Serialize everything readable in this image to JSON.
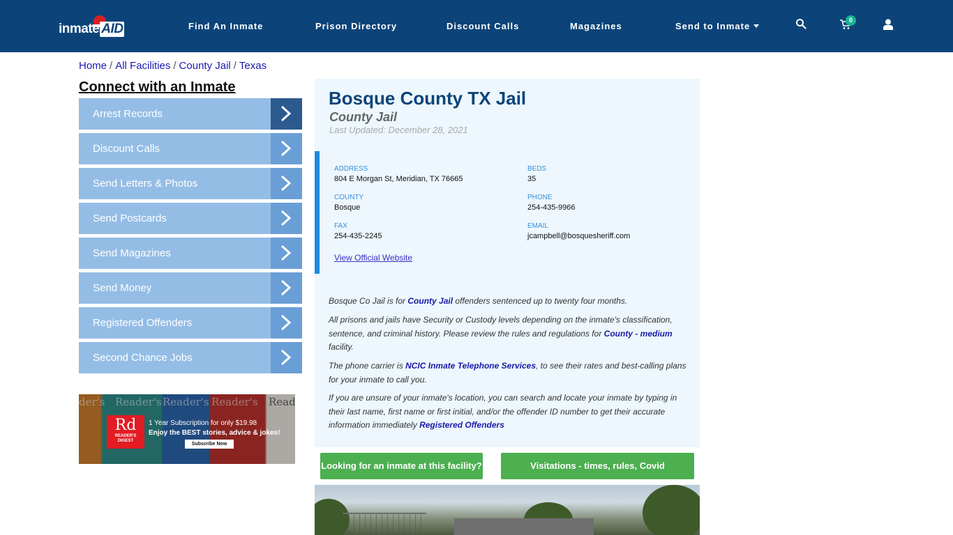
{
  "header": {
    "logo_text": "inmate",
    "logo_accent": "AID",
    "nav": [
      {
        "label": "Find An Inmate"
      },
      {
        "label": "Prison Directory"
      },
      {
        "label": "Discount Calls"
      },
      {
        "label": "Magazines"
      },
      {
        "label": "Send to Inmate"
      }
    ],
    "cart_count": "0",
    "icons": [
      "search-icon",
      "cart-icon",
      "user-icon"
    ]
  },
  "breadcrumb": [
    "Home",
    "All Facilities",
    "County Jail",
    "Texas"
  ],
  "sidebar": {
    "title": "Connect with an Inmate",
    "items": [
      {
        "label": "Arrest Records"
      },
      {
        "label": "Discount Calls"
      },
      {
        "label": "Send Letters & Photos"
      },
      {
        "label": "Send Postcards"
      },
      {
        "label": "Send Magazines"
      },
      {
        "label": "Send Money"
      },
      {
        "label": "Registered Offenders"
      },
      {
        "label": "Second Chance Jobs"
      }
    ]
  },
  "ad": {
    "brand_big": "Rd",
    "brand_small_1": "READER'S",
    "brand_small_2": "DIGEST",
    "line1": "1 Year Subscription for only $19.98",
    "line2": "Enjoy the BEST stories, advice & jokes!",
    "button": "Subscribe Now"
  },
  "facility": {
    "name": "Bosque County TX Jail",
    "type": "County Jail",
    "last_updated": "Last Updated: December 28, 2021",
    "fields": {
      "address_label": "ADDRESS",
      "address": "804 E Morgan St, Meridian, TX 76665",
      "beds_label": "BEDS",
      "beds": "35",
      "county_label": "COUNTY",
      "county": "Bosque",
      "phone_label": "PHONE",
      "phone": "254-435-9966",
      "fax_label": "FAX",
      "fax": "254-435-2245",
      "email_label": "EMAIL",
      "email": "jcampbell@bosquesheriff.com"
    },
    "website_link": "View Official Website",
    "paragraphs": {
      "p1_a": "Bosque Co Jail is for ",
      "p1_link": "County Jail",
      "p1_b": " offenders sentenced up to twenty four months.",
      "p2_a": "All prisons and jails have Security or Custody levels depending on the inmate's classification, sentence, and criminal history. Please review the rules and regulations for ",
      "p2_link": "County - medium",
      "p2_b": " facility.",
      "p3_a": "The phone carrier is ",
      "p3_link": "NCIC Inmate Telephone Services",
      "p3_b": ", to see their rates and best-calling plans for your inmate to call you.",
      "p4_a": "If you are unsure of your inmate's location, you can search and locate your inmate by typing in their last name, first name or first initial, and/or the offender ID number to get their accurate information immediately ",
      "p4_link": "Registered Offenders"
    },
    "buttons": {
      "find_inmate": "Looking for an inmate at this facility?",
      "visitations": "Visitations - times, rules, Covid cancellations"
    }
  },
  "colors": {
    "header_bg": "#0c4479",
    "side_item_bg": "#94bde6",
    "side_arrow_bg": "#6a9ed6",
    "side_arrow_active": "#2d5a8e",
    "card_bg": "#edf7fd",
    "accent_blue": "#1a8ce0",
    "green_button": "#4caf50",
    "badge": "#1ab394"
  }
}
